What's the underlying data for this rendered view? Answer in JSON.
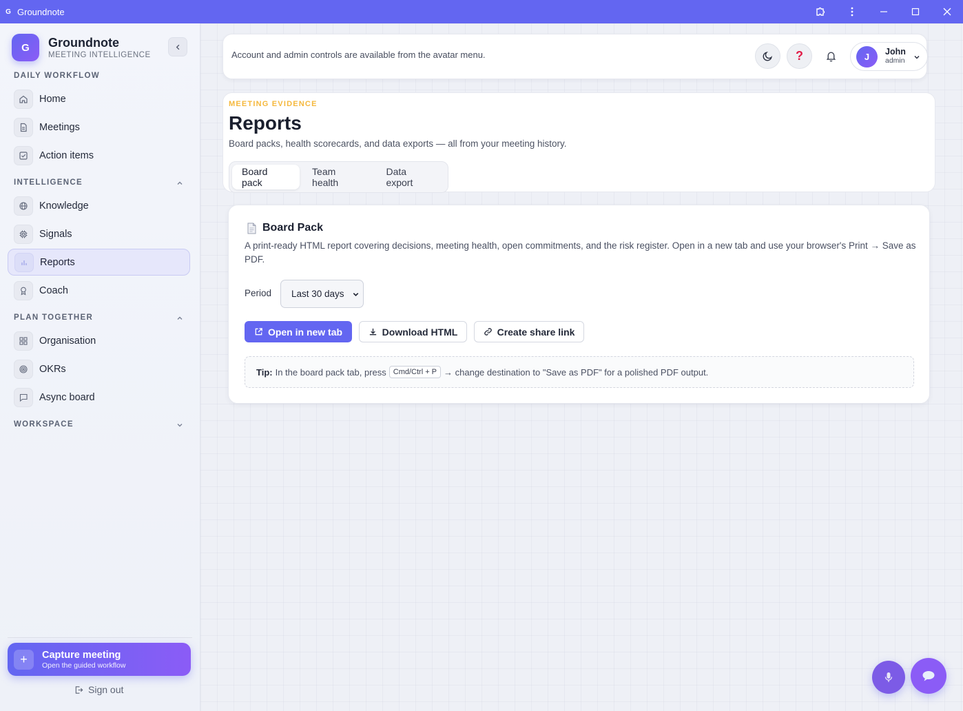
{
  "window": {
    "logo": "G",
    "title": "Groundnote"
  },
  "sidebar": {
    "brand_logo": "G",
    "brand_name": "Groundnote",
    "brand_sub": "MEETING INTELLIGENCE",
    "sections": {
      "daily": "DAILY WORKFLOW",
      "intelligence": "INTELLIGENCE",
      "plan": "PLAN TOGETHER",
      "workspace": "WORKSPACE"
    },
    "items": {
      "home": "Home",
      "meetings": "Meetings",
      "action_items": "Action items",
      "knowledge": "Knowledge",
      "signals": "Signals",
      "reports": "Reports",
      "coach": "Coach",
      "organisation": "Organisation",
      "okrs": "OKRs",
      "async_board": "Async board"
    },
    "capture": {
      "title": "Capture meeting",
      "subtitle": "Open the guided workflow"
    },
    "sign_out": "Sign out"
  },
  "topbar": {
    "note": "Account and admin controls are available from the avatar menu.",
    "help_glyph": "?",
    "user": {
      "initial": "J",
      "name": "John",
      "role": "admin"
    }
  },
  "header": {
    "eyebrow": "MEETING EVIDENCE",
    "title": "Reports",
    "subtitle": "Board packs, health scorecards, and data exports — all from your meeting history.",
    "tabs": [
      "Board pack",
      "Team health",
      "Data export"
    ],
    "active_tab": "Board pack"
  },
  "board_pack": {
    "title": "Board Pack",
    "description": "A print-ready HTML report covering decisions, meeting health, open commitments, and the risk register. Open in a new tab and use your browser's Print → Save as PDF.",
    "period_label": "Period",
    "period_value": "Last 30 days",
    "open_button": "Open in new tab",
    "download_button": "Download HTML",
    "share_button": "Create share link",
    "tip_label": "Tip:",
    "tip_before": "In the board pack tab, press",
    "tip_key": "Cmd/Ctrl + P",
    "tip_after": "→ change destination to \"Save as PDF\" for a polished PDF output."
  },
  "colors": {
    "accent": "#6366f1",
    "accent_secondary": "#8b5cf6",
    "eyebrow": "#f5b83d",
    "help_icon": "#e11d48"
  },
  "icons": {
    "titlebar": [
      "extension-icon",
      "more-vertical-icon",
      "minimize-icon",
      "maximize-icon",
      "close-icon"
    ],
    "fabs": [
      "mic-icon",
      "chat-icon"
    ]
  }
}
